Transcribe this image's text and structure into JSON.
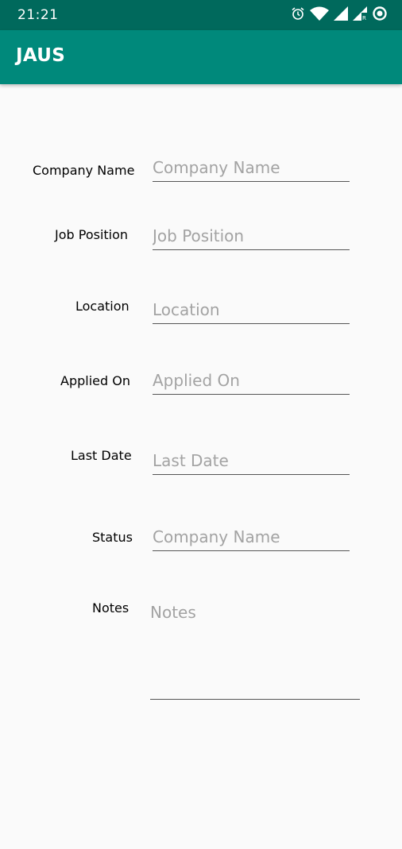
{
  "status_bar": {
    "time": "21:21",
    "icons": [
      "alarm-icon",
      "wifi-icon",
      "signal-icon",
      "signal-roaming-icon",
      "data-saver-icon"
    ]
  },
  "app_bar": {
    "title": "JAUS",
    "color": "#00897b",
    "status_color": "#00695c"
  },
  "form": {
    "company_name": {
      "label": "Company Name",
      "placeholder": "Company Name",
      "value": ""
    },
    "job_position": {
      "label": "Job Position",
      "placeholder": "Job Position",
      "value": ""
    },
    "location": {
      "label": "Location",
      "placeholder": "Location",
      "value": ""
    },
    "applied_on": {
      "label": "Applied On",
      "placeholder": "Applied On",
      "value": ""
    },
    "last_date": {
      "label": "Last Date",
      "placeholder": "Last Date",
      "value": ""
    },
    "status": {
      "label": "Status",
      "placeholder": "Company Name",
      "value": ""
    },
    "notes": {
      "label": "Notes",
      "placeholder": "Notes",
      "value": ""
    }
  }
}
